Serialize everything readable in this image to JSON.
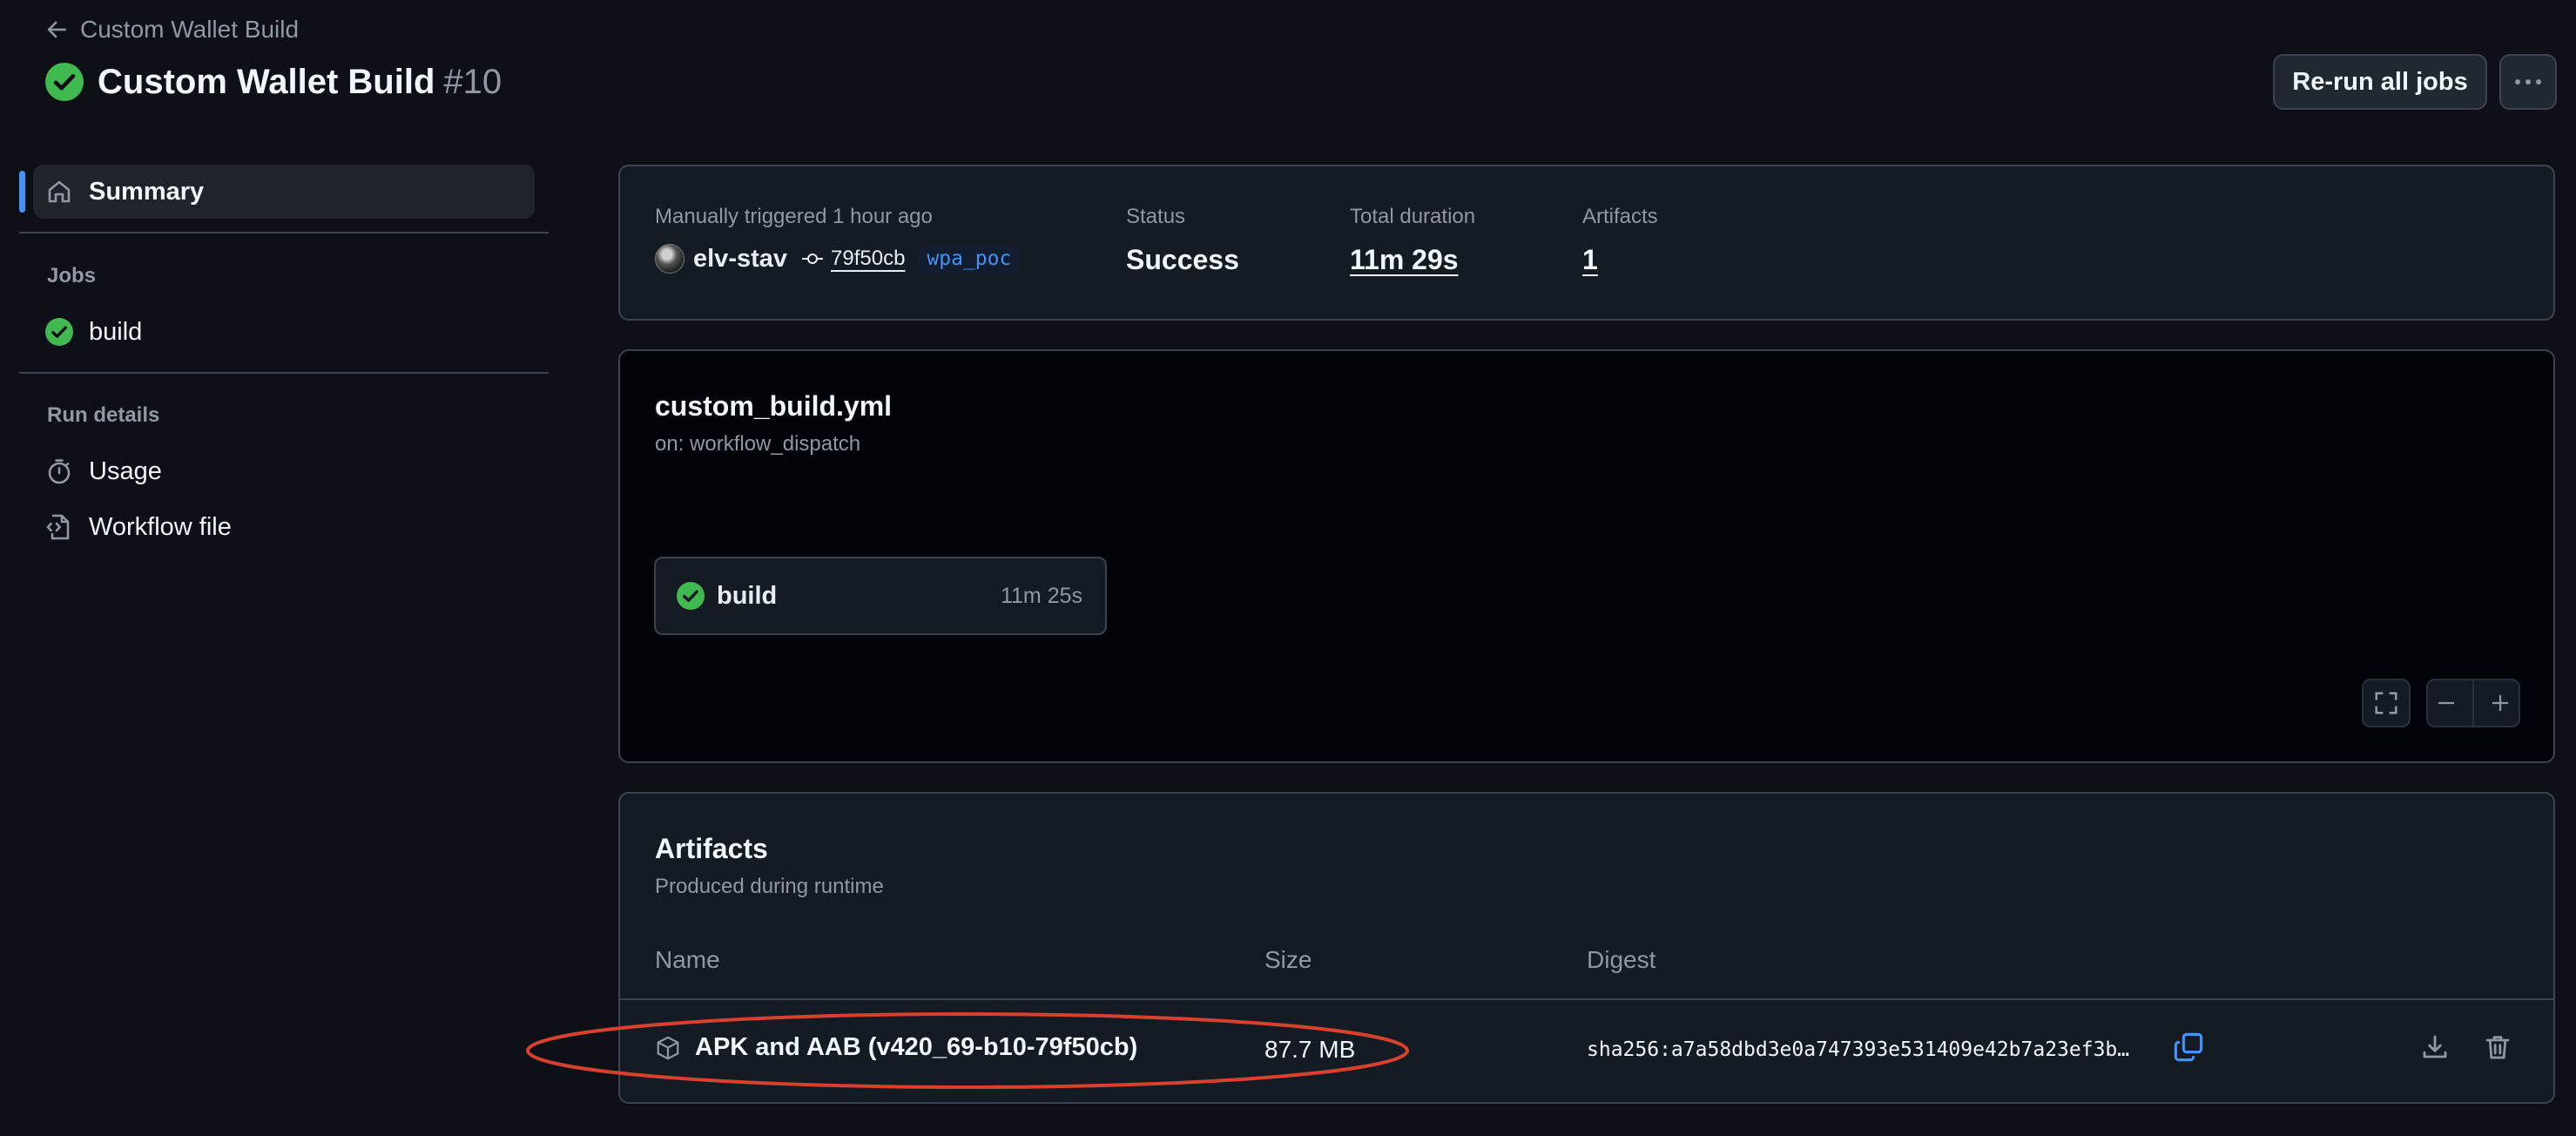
{
  "header": {
    "back_label": "Custom Wallet Build",
    "title": "Custom Wallet Build",
    "run_number": "#10",
    "rerun_label": "Re-run all jobs"
  },
  "sidebar": {
    "summary_label": "Summary",
    "jobs_heading": "Jobs",
    "jobs": [
      {
        "label": "build"
      }
    ],
    "run_details_heading": "Run details",
    "usage_label": "Usage",
    "workflow_file_label": "Workflow file"
  },
  "summary": {
    "trigger_text": "Manually triggered 1 hour ago",
    "actor": "elv-stav",
    "commit": "79f50cb",
    "branch": "wpa_poc",
    "status_label": "Status",
    "status_value": "Success",
    "duration_label": "Total duration",
    "duration_value": "11m 29s",
    "artifacts_label": "Artifacts",
    "artifacts_value": "1"
  },
  "workflow": {
    "file": "custom_build.yml",
    "trigger": "on: workflow_dispatch",
    "job_name": "build",
    "job_duration": "11m 25s"
  },
  "artifacts": {
    "heading": "Artifacts",
    "subheading": "Produced during runtime",
    "columns": [
      "Name",
      "Size",
      "Digest"
    ],
    "rows": [
      {
        "name": "APK and AAB (v420_69-b10-79f50cb)",
        "size": "87.7 MB",
        "digest": "sha256:a7a58dbd3e0a747393e531409e42b7a23ef3b…"
      }
    ]
  },
  "colors": {
    "background": "#0d1117",
    "success": "#3fb950",
    "accent": "#4493f8",
    "annotation": "#d9412e"
  }
}
